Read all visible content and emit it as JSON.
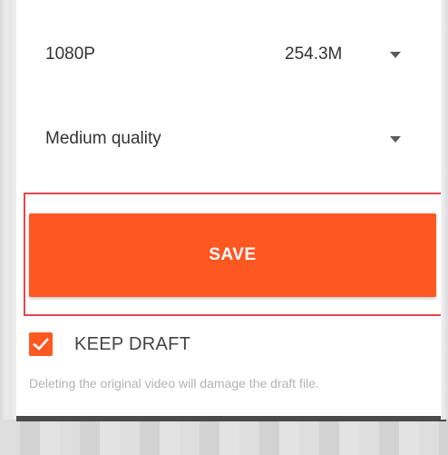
{
  "resolution_row": {
    "value": "1080P",
    "size": "254.3M",
    "arrow_icon": "dropdown-arrow-icon"
  },
  "quality_row": {
    "value": "Medium quality",
    "arrow_icon": "dropdown-arrow-icon"
  },
  "save_button": {
    "label": "SAVE",
    "color": "#fd5722"
  },
  "keep_draft": {
    "label": "KEEP DRAFT",
    "checked": true,
    "icon": "checkmark-icon"
  },
  "hint_text": "Deleting the original video will damage the draft file.",
  "colors": {
    "accent": "#fd5722",
    "highlight_border": "#e2474f"
  }
}
